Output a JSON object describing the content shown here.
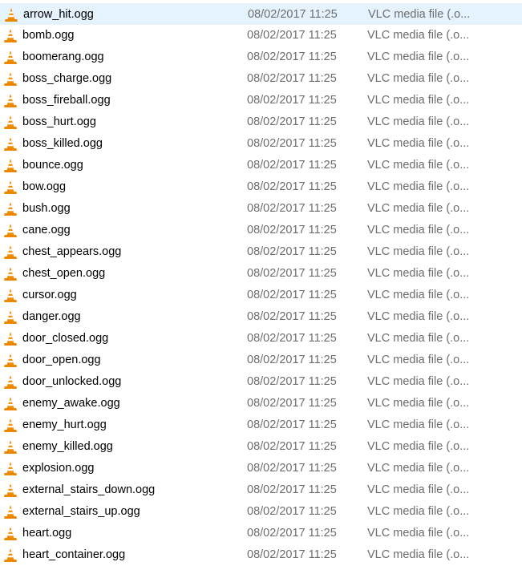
{
  "file_list": {
    "files": [
      {
        "name": "arrow_hit.ogg",
        "date": "08/02/2017 11:25",
        "type": "VLC media file (.o..."
      },
      {
        "name": "bomb.ogg",
        "date": "08/02/2017 11:25",
        "type": "VLC media file (.o..."
      },
      {
        "name": "boomerang.ogg",
        "date": "08/02/2017 11:25",
        "type": "VLC media file (.o..."
      },
      {
        "name": "boss_charge.ogg",
        "date": "08/02/2017 11:25",
        "type": "VLC media file (.o..."
      },
      {
        "name": "boss_fireball.ogg",
        "date": "08/02/2017 11:25",
        "type": "VLC media file (.o..."
      },
      {
        "name": "boss_hurt.ogg",
        "date": "08/02/2017 11:25",
        "type": "VLC media file (.o..."
      },
      {
        "name": "boss_killed.ogg",
        "date": "08/02/2017 11:25",
        "type": "VLC media file (.o..."
      },
      {
        "name": "bounce.ogg",
        "date": "08/02/2017 11:25",
        "type": "VLC media file (.o..."
      },
      {
        "name": "bow.ogg",
        "date": "08/02/2017 11:25",
        "type": "VLC media file (.o..."
      },
      {
        "name": "bush.ogg",
        "date": "08/02/2017 11:25",
        "type": "VLC media file (.o..."
      },
      {
        "name": "cane.ogg",
        "date": "08/02/2017 11:25",
        "type": "VLC media file (.o..."
      },
      {
        "name": "chest_appears.ogg",
        "date": "08/02/2017 11:25",
        "type": "VLC media file (.o..."
      },
      {
        "name": "chest_open.ogg",
        "date": "08/02/2017 11:25",
        "type": "VLC media file (.o..."
      },
      {
        "name": "cursor.ogg",
        "date": "08/02/2017 11:25",
        "type": "VLC media file (.o..."
      },
      {
        "name": "danger.ogg",
        "date": "08/02/2017 11:25",
        "type": "VLC media file (.o..."
      },
      {
        "name": "door_closed.ogg",
        "date": "08/02/2017 11:25",
        "type": "VLC media file (.o..."
      },
      {
        "name": "door_open.ogg",
        "date": "08/02/2017 11:25",
        "type": "VLC media file (.o..."
      },
      {
        "name": "door_unlocked.ogg",
        "date": "08/02/2017 11:25",
        "type": "VLC media file (.o..."
      },
      {
        "name": "enemy_awake.ogg",
        "date": "08/02/2017 11:25",
        "type": "VLC media file (.o..."
      },
      {
        "name": "enemy_hurt.ogg",
        "date": "08/02/2017 11:25",
        "type": "VLC media file (.o..."
      },
      {
        "name": "enemy_killed.ogg",
        "date": "08/02/2017 11:25",
        "type": "VLC media file (.o..."
      },
      {
        "name": "explosion.ogg",
        "date": "08/02/2017 11:25",
        "type": "VLC media file (.o..."
      },
      {
        "name": "external_stairs_down.ogg",
        "date": "08/02/2017 11:25",
        "type": "VLC media file (.o..."
      },
      {
        "name": "external_stairs_up.ogg",
        "date": "08/02/2017 11:25",
        "type": "VLC media file (.o..."
      },
      {
        "name": "heart.ogg",
        "date": "08/02/2017 11:25",
        "type": "VLC media file (.o..."
      },
      {
        "name": "heart_container.ogg",
        "date": "08/02/2017 11:25",
        "type": "VLC media file (.o..."
      }
    ],
    "file_icon": "vlc-cone-icon",
    "selected_index": 0
  },
  "colors": {
    "selection": "#e5f3ff",
    "name_text": "#000000",
    "detail_text": "#6d6d6d",
    "icon_orange": "#f08c00",
    "icon_stripe": "#ffffff"
  }
}
